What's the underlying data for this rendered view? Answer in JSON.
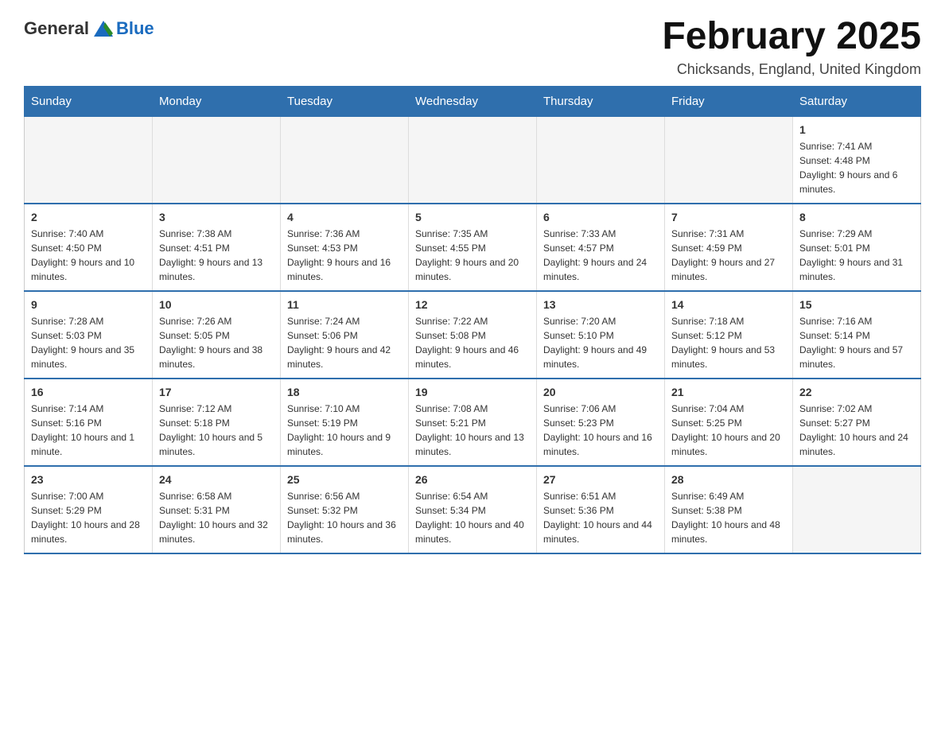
{
  "header": {
    "logo_text_general": "General",
    "logo_text_blue": "Blue",
    "title": "February 2025",
    "subtitle": "Chicksands, England, United Kingdom"
  },
  "days_of_week": [
    "Sunday",
    "Monday",
    "Tuesday",
    "Wednesday",
    "Thursday",
    "Friday",
    "Saturday"
  ],
  "weeks": [
    {
      "days": [
        {
          "number": "",
          "info": ""
        },
        {
          "number": "",
          "info": ""
        },
        {
          "number": "",
          "info": ""
        },
        {
          "number": "",
          "info": ""
        },
        {
          "number": "",
          "info": ""
        },
        {
          "number": "",
          "info": ""
        },
        {
          "number": "1",
          "info": "Sunrise: 7:41 AM\nSunset: 4:48 PM\nDaylight: 9 hours and 6 minutes."
        }
      ]
    },
    {
      "days": [
        {
          "number": "2",
          "info": "Sunrise: 7:40 AM\nSunset: 4:50 PM\nDaylight: 9 hours and 10 minutes."
        },
        {
          "number": "3",
          "info": "Sunrise: 7:38 AM\nSunset: 4:51 PM\nDaylight: 9 hours and 13 minutes."
        },
        {
          "number": "4",
          "info": "Sunrise: 7:36 AM\nSunset: 4:53 PM\nDaylight: 9 hours and 16 minutes."
        },
        {
          "number": "5",
          "info": "Sunrise: 7:35 AM\nSunset: 4:55 PM\nDaylight: 9 hours and 20 minutes."
        },
        {
          "number": "6",
          "info": "Sunrise: 7:33 AM\nSunset: 4:57 PM\nDaylight: 9 hours and 24 minutes."
        },
        {
          "number": "7",
          "info": "Sunrise: 7:31 AM\nSunset: 4:59 PM\nDaylight: 9 hours and 27 minutes."
        },
        {
          "number": "8",
          "info": "Sunrise: 7:29 AM\nSunset: 5:01 PM\nDaylight: 9 hours and 31 minutes."
        }
      ]
    },
    {
      "days": [
        {
          "number": "9",
          "info": "Sunrise: 7:28 AM\nSunset: 5:03 PM\nDaylight: 9 hours and 35 minutes."
        },
        {
          "number": "10",
          "info": "Sunrise: 7:26 AM\nSunset: 5:05 PM\nDaylight: 9 hours and 38 minutes."
        },
        {
          "number": "11",
          "info": "Sunrise: 7:24 AM\nSunset: 5:06 PM\nDaylight: 9 hours and 42 minutes."
        },
        {
          "number": "12",
          "info": "Sunrise: 7:22 AM\nSunset: 5:08 PM\nDaylight: 9 hours and 46 minutes."
        },
        {
          "number": "13",
          "info": "Sunrise: 7:20 AM\nSunset: 5:10 PM\nDaylight: 9 hours and 49 minutes."
        },
        {
          "number": "14",
          "info": "Sunrise: 7:18 AM\nSunset: 5:12 PM\nDaylight: 9 hours and 53 minutes."
        },
        {
          "number": "15",
          "info": "Sunrise: 7:16 AM\nSunset: 5:14 PM\nDaylight: 9 hours and 57 minutes."
        }
      ]
    },
    {
      "days": [
        {
          "number": "16",
          "info": "Sunrise: 7:14 AM\nSunset: 5:16 PM\nDaylight: 10 hours and 1 minute."
        },
        {
          "number": "17",
          "info": "Sunrise: 7:12 AM\nSunset: 5:18 PM\nDaylight: 10 hours and 5 minutes."
        },
        {
          "number": "18",
          "info": "Sunrise: 7:10 AM\nSunset: 5:19 PM\nDaylight: 10 hours and 9 minutes."
        },
        {
          "number": "19",
          "info": "Sunrise: 7:08 AM\nSunset: 5:21 PM\nDaylight: 10 hours and 13 minutes."
        },
        {
          "number": "20",
          "info": "Sunrise: 7:06 AM\nSunset: 5:23 PM\nDaylight: 10 hours and 16 minutes."
        },
        {
          "number": "21",
          "info": "Sunrise: 7:04 AM\nSunset: 5:25 PM\nDaylight: 10 hours and 20 minutes."
        },
        {
          "number": "22",
          "info": "Sunrise: 7:02 AM\nSunset: 5:27 PM\nDaylight: 10 hours and 24 minutes."
        }
      ]
    },
    {
      "days": [
        {
          "number": "23",
          "info": "Sunrise: 7:00 AM\nSunset: 5:29 PM\nDaylight: 10 hours and 28 minutes."
        },
        {
          "number": "24",
          "info": "Sunrise: 6:58 AM\nSunset: 5:31 PM\nDaylight: 10 hours and 32 minutes."
        },
        {
          "number": "25",
          "info": "Sunrise: 6:56 AM\nSunset: 5:32 PM\nDaylight: 10 hours and 36 minutes."
        },
        {
          "number": "26",
          "info": "Sunrise: 6:54 AM\nSunset: 5:34 PM\nDaylight: 10 hours and 40 minutes."
        },
        {
          "number": "27",
          "info": "Sunrise: 6:51 AM\nSunset: 5:36 PM\nDaylight: 10 hours and 44 minutes."
        },
        {
          "number": "28",
          "info": "Sunrise: 6:49 AM\nSunset: 5:38 PM\nDaylight: 10 hours and 48 minutes."
        },
        {
          "number": "",
          "info": ""
        }
      ]
    }
  ]
}
